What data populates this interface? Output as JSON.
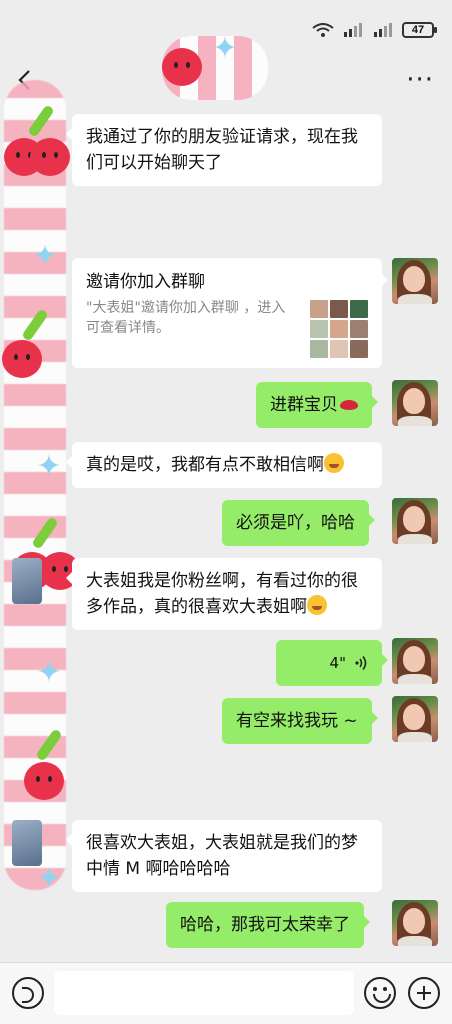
{
  "status_bar": {
    "battery": "47"
  },
  "header": {
    "more_label": "···"
  },
  "messages": [
    {
      "side": "left",
      "text": "我通过了你的朋友验证请求，现在我们可以开始聊天了"
    },
    {
      "side": "right",
      "type": "card",
      "title": "邀请你加入群聊",
      "desc": "\"大表姐\"邀请你加入群聊 ，进入可查看详情。"
    },
    {
      "side": "right",
      "text": "进群宝贝",
      "emoji": "lips"
    },
    {
      "side": "left",
      "text": "真的是哎，我都有点不敢相信啊",
      "emoji": "laughing"
    },
    {
      "side": "right",
      "text": "必须是吖，哈哈"
    },
    {
      "side": "left",
      "text": "大表姐我是你粉丝啊，有看过你的很多作品，真的很喜欢大表姐啊",
      "emoji": "laughing"
    },
    {
      "side": "right",
      "type": "voice",
      "duration": "4\""
    },
    {
      "side": "right",
      "text": "有空来找我玩 ~"
    },
    {
      "side": "left",
      "text": "很喜欢大表姐，大表姐就是我们的梦中情 M 啊哈哈哈哈"
    },
    {
      "side": "right",
      "text": "哈哈，那我可太荣幸了"
    }
  ],
  "input": {
    "placeholder": ""
  },
  "icons": [
    "back-arrow-icon",
    "more-icon",
    "wifi-icon",
    "signal-icon",
    "battery-icon",
    "voice-icon",
    "emoji-icon",
    "plus-icon"
  ]
}
